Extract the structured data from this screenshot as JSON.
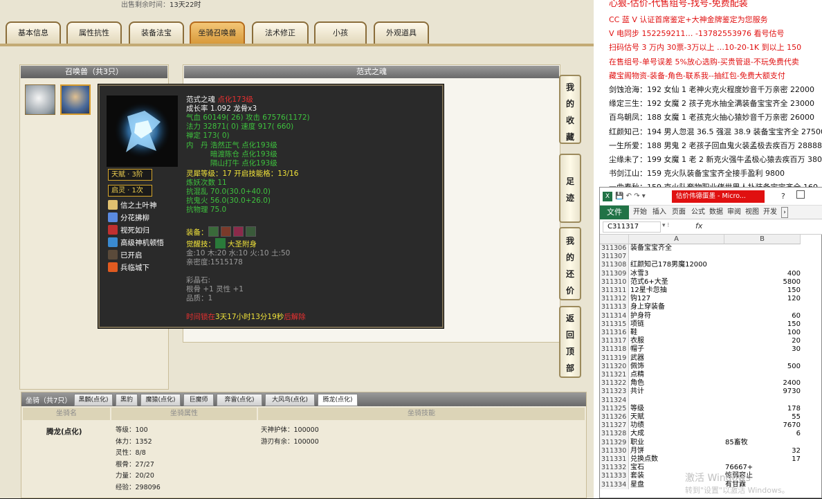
{
  "game": {
    "sale_time_label": "出售剩余时间：",
    "sale_time_value": "13天22时",
    "tabs": [
      "基本信息",
      "属性抗性",
      "装备法宝",
      "坐骑召唤兽",
      "法术修正",
      "小孩",
      "外观道具"
    ],
    "active_tab": 3,
    "summon_panel_title": "召唤兽（共3只）",
    "detail_panel_title": "范式之魂",
    "side_buttons": [
      {
        "label": [
          "我",
          "的",
          "收",
          "藏"
        ]
      },
      {
        "label": [
          "足",
          "迹"
        ]
      },
      {
        "label": [
          "我",
          "的",
          "还",
          "价"
        ]
      },
      {
        "label": [
          "返",
          "回",
          "顶",
          "部"
        ]
      }
    ]
  },
  "tooltip": {
    "name": "范式之魂",
    "level": "点化173级",
    "growth": "成长率 1.092 龙骨x3",
    "hp_attack": "气血 60149( 26) 攻击 67576(1172)",
    "mp_speed": "法力 32871( 0) 速度 917( 660)",
    "zen": "禅定 173( 0)",
    "neidan": [
      "内　丹 浩然正气 点化193级",
      "　　　 暗渡陈仓 点化193级",
      "　　　 隔山打牛 点化193级"
    ],
    "spirit": "灵犀等级：17 开启技能格：13/16",
    "refine": "炼妖次数 11",
    "resist1": "抗混乱 70.0(30.0+40.0)",
    "resist2": "抗鬼火 56.0(30.0+26.0)",
    "resist3": "抗物理 75.0",
    "equip_label": "装备：",
    "awaken_label": "觉醒技：",
    "awaken_skill": "大圣附身",
    "elements": "金:10 木:20 水:10 火:10 土:50",
    "intimacy": "亲密度:1515178",
    "gems_label": "彩晶石:",
    "gem1": "根骨 +1 灵性 +1",
    "gem2": "品质：1",
    "time_prefix": "时间锁在",
    "time_value": "3天17小时13分19秒",
    "time_suffix": "后解除",
    "talent_badge": "天赋 · 3阶",
    "qiling_badge": "启灵 · 1次",
    "skills": [
      {
        "name": "信之土叶神",
        "icon": "scroll-icon",
        "color": "#e0c070"
      },
      {
        "name": "分花拂柳",
        "icon": "flower-icon",
        "color": "#5a8ae0"
      },
      {
        "name": "视死如归",
        "icon": "skull-icon",
        "color": "#c03030"
      },
      {
        "name": "高级神机顿悟",
        "icon": "figure-icon",
        "color": "#3a8ad0"
      },
      {
        "name": "已开启",
        "icon": "lock-icon",
        "color": "#5a4a3a"
      },
      {
        "name": "兵临城下",
        "icon": "fire-icon",
        "color": "#e05a20"
      }
    ]
  },
  "mount": {
    "section_title": "坐骑（共7只）",
    "tabs": [
      "黑麟(点化)",
      "黑豹",
      "魔猿(点化)",
      "巨魔师",
      "奔雷(点化)",
      "大风鸟(点化)",
      "腾龙(点化)"
    ],
    "active_tab": 6,
    "headers": [
      "坐骑名",
      "坐骑属性",
      "坐骑技能"
    ],
    "name": "腾龙(点化)",
    "attrs": [
      "等级：100",
      "体力：1352",
      "灵性：8/8",
      "根骨：27/27",
      "力量：20/20",
      "经验：298096"
    ],
    "skills": [
      "天神护体：100000",
      "游刃有余：100000"
    ]
  },
  "right_panel": {
    "lines": [
      {
        "text": "CC 蓝 V 认证首席鉴定+大神金牌鉴定为您服务",
        "color": "#e01010"
      },
      {
        "text": "V 电同步 152259211… -13782553976 看号估号",
        "color": "#e01010"
      },
      {
        "text": "扫码估号 3 万内 30票-3万以上 …10-20-1K 到以上 150",
        "color": "#e01010"
      },
      {
        "text": "在售组号-单号误差 5%放心选购-买贵管退-不玩免费代卖",
        "color": "#e01010"
      },
      {
        "text": "藏宝阁物资-装备-角色-联系我--抽红包-免费大额支付",
        "color": "#e01010"
      },
      {
        "text": "剑蚀沧海：192 女仙 1 老神火克火程度妙音千万亲密 22000",
        "color": "#111111"
      },
      {
        "text": "缘定三生：192 女魔 2 孩子克水抽全满装备宝宝齐全 23000",
        "color": "#111111"
      },
      {
        "text": "百鸟朝凤：188 女魔 1 老孩克火抽心猿妙音千万亲密 26000",
        "color": "#111111"
      },
      {
        "text": "红颜知己：194 男人忽混 36.5 强混 38.9 装备宝宝齐全 27500",
        "color": "#111111"
      },
      {
        "text": "一生所爱：188 男鬼 2 老孩子回血鬼火装孟极去疾百万 28888",
        "color": "#111111"
      },
      {
        "text": "尘缘未了：199 女魔 1 老 2 新克火强牛孟极心猿去疾百万 380",
        "color": "#111111"
      },
      {
        "text": "书剑江山：159 克火队装备宝宝齐全接手盈利 9800",
        "color": "#111111"
      },
      {
        "text": "一曲春秋：159 克火队套物职业佬世男人扑装备宝宝齐全 160",
        "color": "#111111"
      }
    ]
  },
  "excel": {
    "title": "估价伟德蛋墨 - Micro...",
    "ribbon_tabs": [
      "开始",
      "插入",
      "页面",
      "公式",
      "数据",
      "审阅",
      "视图",
      "开发"
    ],
    "file_label": "文件",
    "name_box": "C311317",
    "fx_label": "fx",
    "col_headers": [
      "A",
      "B"
    ],
    "rows": [
      {
        "n": "311306",
        "a": "装备宝宝齐全",
        "b": ""
      },
      {
        "n": "311307",
        "a": "",
        "b": ""
      },
      {
        "n": "311308",
        "a": "红颜知己178男魔12000",
        "b": ""
      },
      {
        "n": "311309",
        "a": "冰雪3",
        "b": "400"
      },
      {
        "n": "311310",
        "a": "范式6+大圣",
        "b": "5800"
      },
      {
        "n": "311311",
        "a": "12星卡忽抽",
        "b": "150"
      },
      {
        "n": "311312",
        "a": "钩127",
        "b": "120"
      },
      {
        "n": "311313",
        "a": "身上穿装备",
        "b": ""
      },
      {
        "n": "311314",
        "a": "护身符",
        "b": "60"
      },
      {
        "n": "311315",
        "a": "项链",
        "b": "150"
      },
      {
        "n": "311316",
        "a": "鞋",
        "b": "100"
      },
      {
        "n": "311317",
        "a": "衣服",
        "b": "20"
      },
      {
        "n": "311318",
        "a": "帽子",
        "b": "30"
      },
      {
        "n": "311319",
        "a": "武器",
        "b": ""
      },
      {
        "n": "311320",
        "a": "佩饰",
        "b": "500"
      },
      {
        "n": "311321",
        "a": "点精",
        "b": ""
      },
      {
        "n": "311322",
        "a": "角色",
        "b": "2400"
      },
      {
        "n": "311323",
        "a": "共计",
        "b": "9730"
      },
      {
        "n": "311324",
        "a": "",
        "b": ""
      },
      {
        "n": "311325",
        "a": "等级",
        "b": "178"
      },
      {
        "n": "311326",
        "a": "天赋",
        "b": "55"
      },
      {
        "n": "311327",
        "a": "功绩",
        "b": "7670"
      },
      {
        "n": "311328",
        "a": "大成",
        "b": "6"
      },
      {
        "n": "311329",
        "a": "职业",
        "b2": "85畜牧"
      },
      {
        "n": "311330",
        "a": "月饼",
        "b": "32"
      },
      {
        "n": "311331",
        "a": "兑换点数",
        "b": "17"
      },
      {
        "n": "311332",
        "a": "宝石",
        "b2": "76667+"
      },
      {
        "n": "311333",
        "a": "套装",
        "b2": "惊弱容止"
      },
      {
        "n": "311334",
        "a": "星盘",
        "b2": "有甘霖"
      }
    ],
    "watermark_title": "激活 Windows",
    "watermark_sub": "转到\"设置\"以激活 Windows。"
  }
}
